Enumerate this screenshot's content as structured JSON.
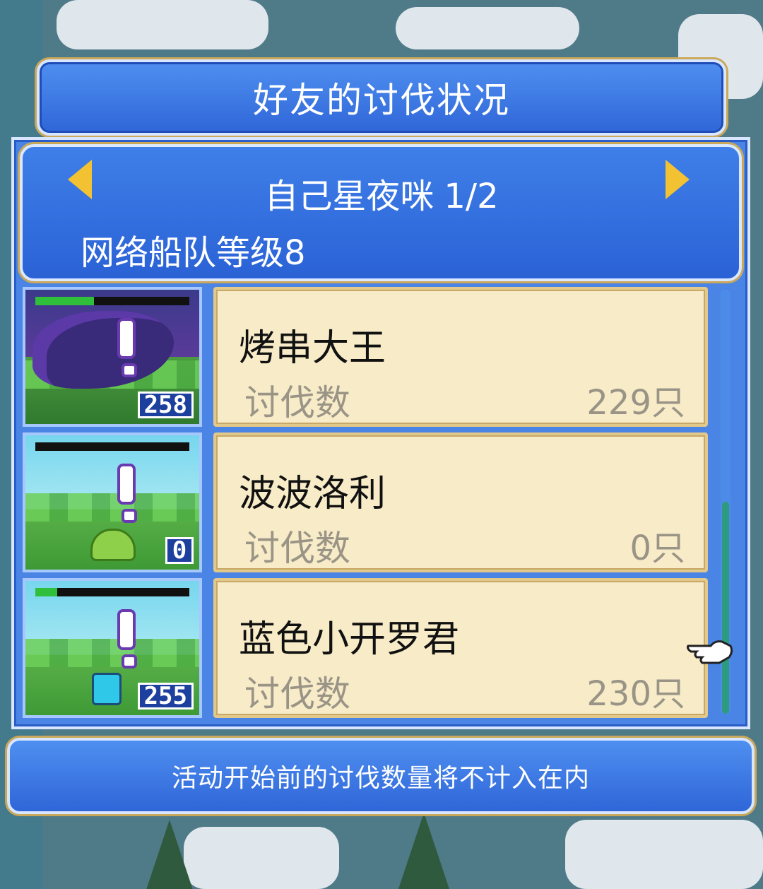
{
  "title": "好友的讨伐状况",
  "player": {
    "name": "自己星夜咪",
    "page": "1/2"
  },
  "fleet_level": "网络船队等级8",
  "kill_label": "讨伐数",
  "entries": [
    {
      "name": "烤串大王",
      "kills": "229只",
      "stage_count": "258",
      "hp_fill": 0.38,
      "hp_color": "#2fbf3a"
    },
    {
      "name": "波波洛利",
      "kills": "0只",
      "stage_count": "0",
      "hp_fill": 0,
      "hp_color": "#2fbf3a"
    },
    {
      "name": "蓝色小开罗君",
      "kills": "230只",
      "stage_count": "255",
      "hp_fill": 0.14,
      "hp_color": "#2fbf3a"
    }
  ],
  "footer_note": "活动开始前的讨伐数量将不计入在内",
  "icons": {
    "prev": "arrow-left-icon",
    "next": "arrow-right-icon",
    "cursor": "pointing-hand-icon"
  },
  "colors": {
    "accent_gold": "#f2c232",
    "panel_blue": "#2f66d8",
    "card_bg": "#f7ebc8"
  }
}
